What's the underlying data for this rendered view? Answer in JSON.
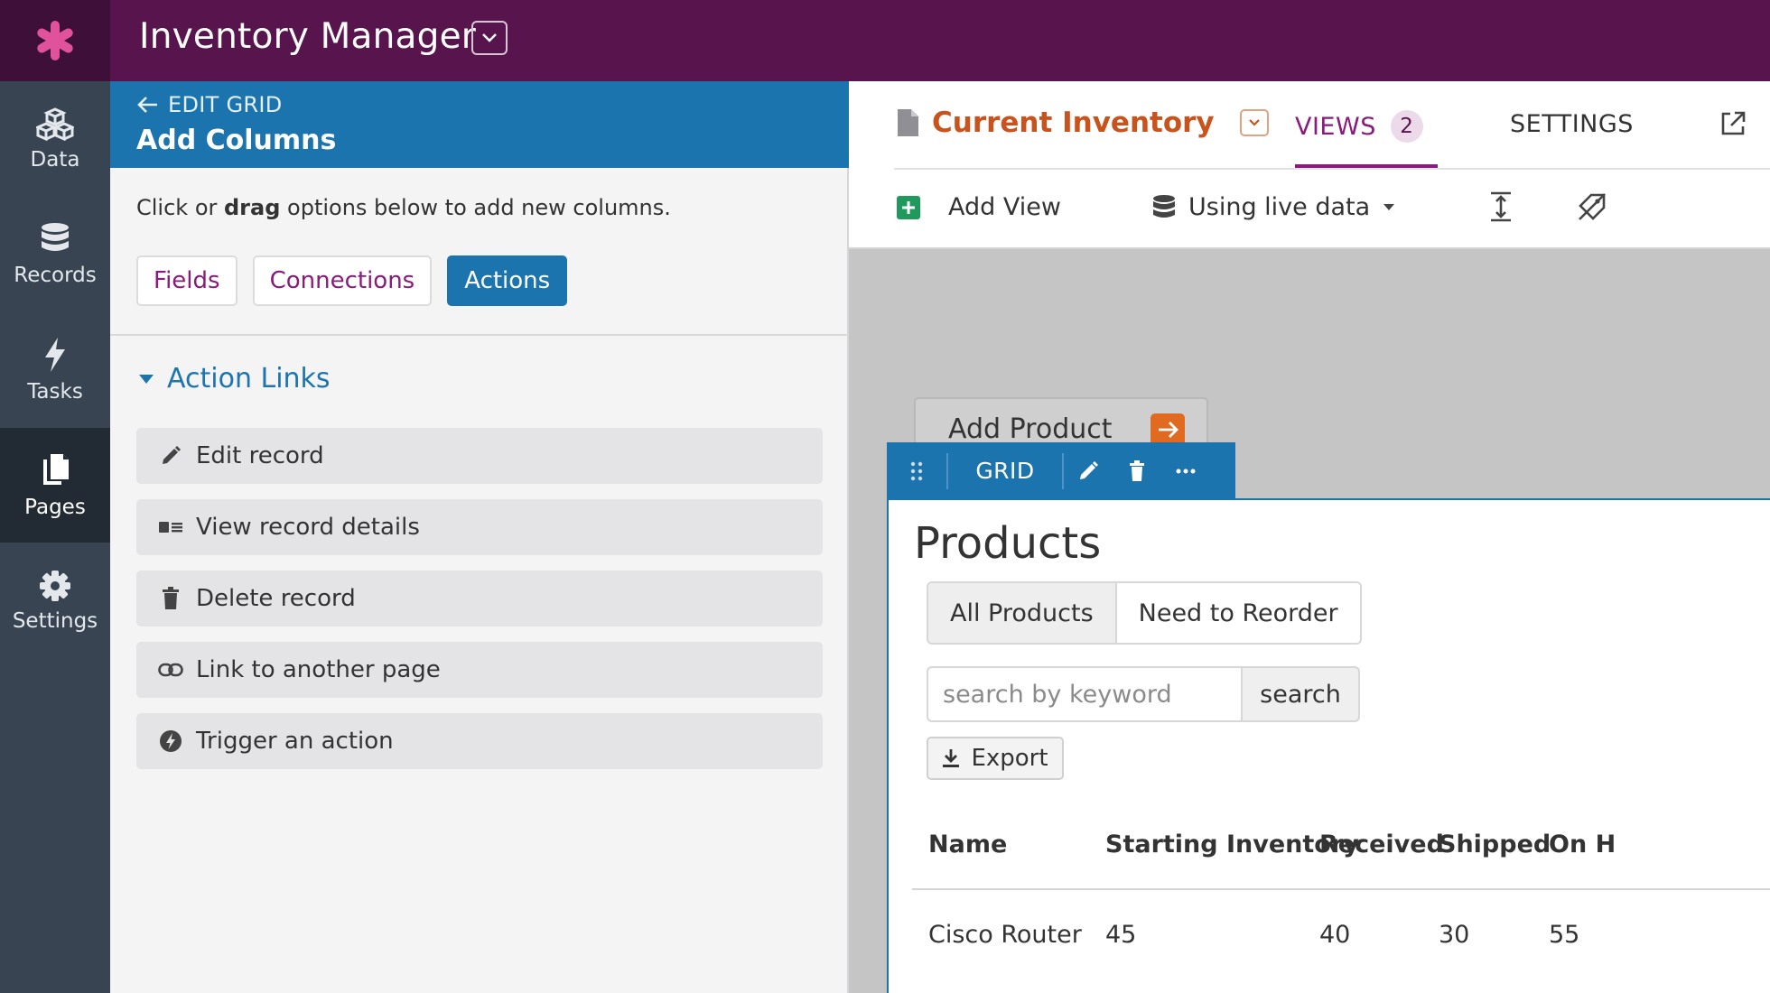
{
  "app": {
    "title": "Inventory Manager"
  },
  "nav": {
    "items": [
      {
        "label": "Data",
        "icon": "cubes-icon"
      },
      {
        "label": "Records",
        "icon": "database-icon"
      },
      {
        "label": "Tasks",
        "icon": "bolt-icon"
      },
      {
        "label": "Pages",
        "icon": "pages-icon",
        "active": true
      },
      {
        "label": "Settings",
        "icon": "gear-icon"
      }
    ]
  },
  "builder": {
    "back_label": "EDIT GRID",
    "title": "Add Columns",
    "intro_before": "Click or ",
    "intro_bold": "drag",
    "intro_after": " options below to add new columns.",
    "tabs": [
      {
        "label": "Fields"
      },
      {
        "label": "Connections"
      },
      {
        "label": "Actions",
        "active": true
      }
    ],
    "section_title": "Action Links",
    "actions": [
      {
        "label": "Edit record",
        "icon": "pencil-icon"
      },
      {
        "label": "View record details",
        "icon": "details-icon"
      },
      {
        "label": "Delete record",
        "icon": "trash-icon"
      },
      {
        "label": "Link to another page",
        "icon": "link-icon"
      },
      {
        "label": "Trigger an action",
        "icon": "bolt-circle-icon"
      }
    ]
  },
  "page": {
    "name": "Current Inventory",
    "views_label": "VIEWS",
    "views_count": "2",
    "settings_label": "SETTINGS",
    "add_view_label": "Add View",
    "live_data_label": "Using live data"
  },
  "canvas": {
    "add_product_label": "Add Product",
    "view_type_label": "GRID",
    "grid": {
      "title": "Products",
      "filters": [
        {
          "label": "All Products",
          "active": true
        },
        {
          "label": "Need to Reorder"
        }
      ],
      "search_placeholder": "search by keyword",
      "search_button": "search",
      "export_label": "Export",
      "columns": [
        "Name",
        "Starting Inventory",
        "Received",
        "Shipped",
        "On H"
      ],
      "rows": [
        [
          "Cisco Router",
          "45",
          "40",
          "30",
          "55"
        ]
      ]
    }
  },
  "colors": {
    "topbar": "#57144d",
    "accent_blue": "#1c74ae",
    "brand_purple": "#8a1a7c",
    "accent_orange": "#c9531c",
    "nav_bg": "#384451",
    "logo_pink": "#e0529c"
  }
}
